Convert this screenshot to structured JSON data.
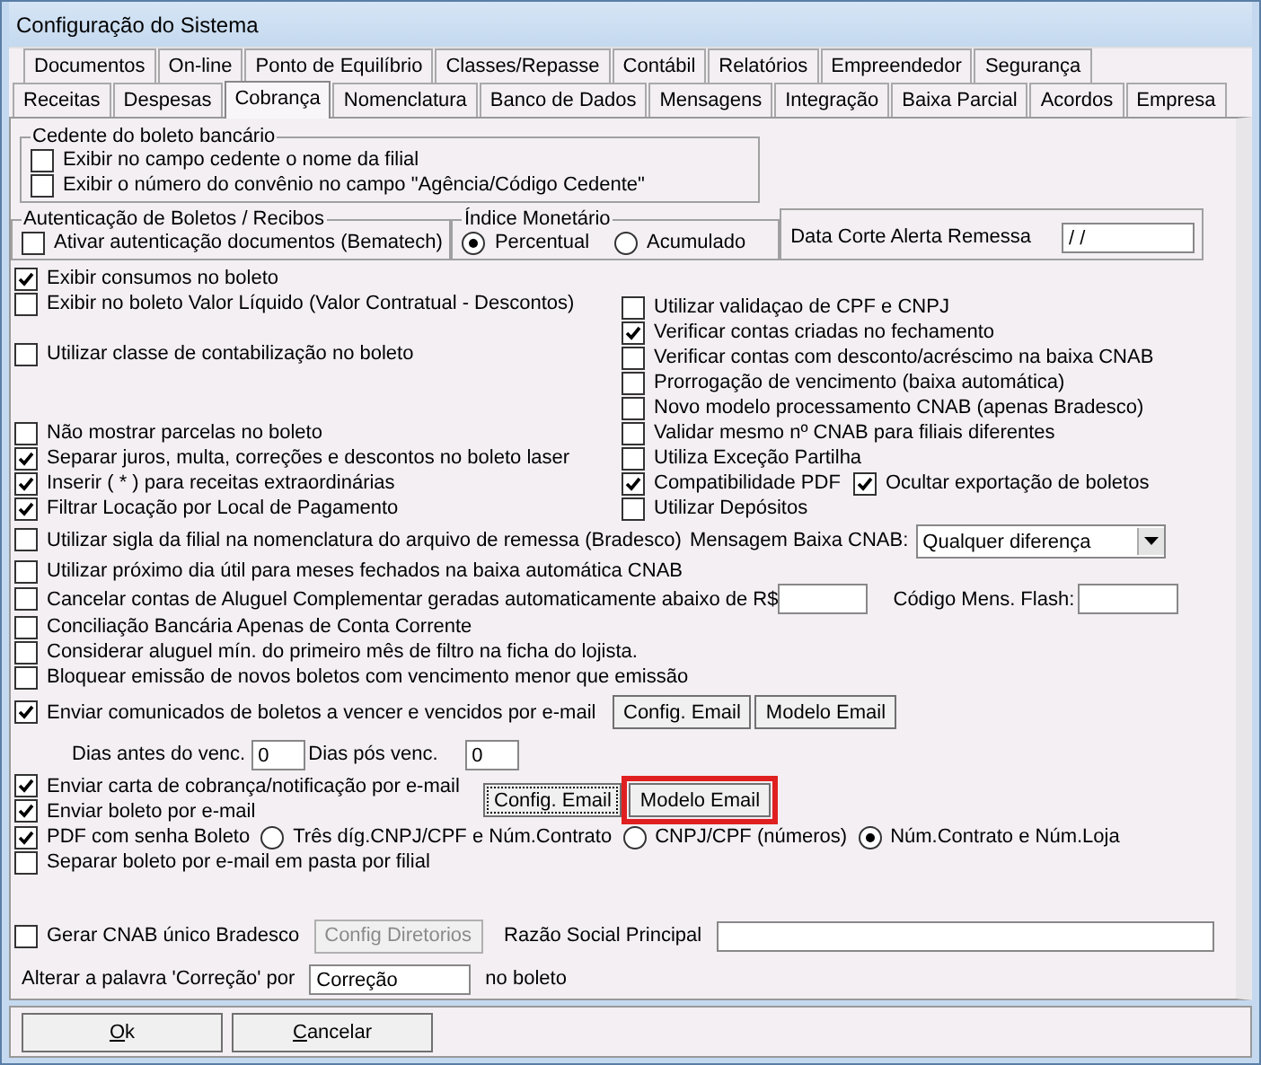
{
  "window": {
    "title": "Configuração do Sistema"
  },
  "tabs_row_1": [
    {
      "label": "Documentos",
      "selected": false
    },
    {
      "label": "On-line",
      "selected": false
    },
    {
      "label": "Ponto de Equilíbrio",
      "selected": false
    },
    {
      "label": "Classes/Repasse",
      "selected": false
    },
    {
      "label": "Contábil",
      "selected": false
    },
    {
      "label": "Relatórios",
      "selected": false
    },
    {
      "label": "Empreendedor",
      "selected": false
    },
    {
      "label": "Segurança",
      "selected": false
    }
  ],
  "tabs_row_2": [
    {
      "label": "Receitas",
      "selected": false
    },
    {
      "label": "Despesas",
      "selected": false
    },
    {
      "label": "Cobrança",
      "selected": true
    },
    {
      "label": "Nomenclatura",
      "selected": false
    },
    {
      "label": "Banco de Dados",
      "selected": false
    },
    {
      "label": "Mensagens",
      "selected": false
    },
    {
      "label": "Integração",
      "selected": false
    },
    {
      "label": "Baixa Parcial",
      "selected": false
    },
    {
      "label": "Acordos",
      "selected": false
    },
    {
      "label": "Empresa",
      "selected": false
    }
  ],
  "cedente_group": {
    "title": "Cedente do boleto bancário",
    "options": [
      {
        "label": "Exibir no campo cedente o nome da filial",
        "checked": false
      },
      {
        "label": "Exibir o número do convênio no campo \"Agência/Código Cedente\"",
        "checked": false
      }
    ]
  },
  "autenticacao_group": {
    "title": "Autenticação de Boletos / Recibos",
    "option": {
      "label": "Ativar autenticação documentos (Bematech)",
      "checked": false
    }
  },
  "indice_group": {
    "title": "Índice Monetário",
    "options": [
      {
        "label": "Percentual",
        "selected": true
      },
      {
        "label": "Acumulado",
        "selected": false
      }
    ]
  },
  "data_corte": {
    "label": "Data Corte Alerta Remessa",
    "value": "/ /"
  },
  "left_blocks": [
    {
      "options": [
        {
          "label": "Exibir consumos no boleto",
          "checked": true
        },
        {
          "label": "Exibir no boleto Valor Líquido (Valor Contratual - Descontos)",
          "checked": false
        }
      ]
    },
    {
      "options": [
        {
          "label": "Utilizar classe de contabilização no boleto",
          "checked": false
        }
      ]
    },
    {
      "options": [
        {
          "label": "Não mostrar parcelas no boleto",
          "checked": false
        },
        {
          "label": "Separar juros, multa, correções e descontos no boleto laser",
          "checked": true
        },
        {
          "label": "Inserir ( * ) para receitas extraordinárias",
          "checked": true
        },
        {
          "label": "Filtrar Locação por Local de Pagamento",
          "checked": true
        }
      ]
    }
  ],
  "right_options": [
    {
      "label": "Utilizar validaçao de CPF e CNPJ",
      "checked": false
    },
    {
      "label": "Verificar contas criadas no fechamento",
      "checked": true
    },
    {
      "label": "Verificar contas com desconto/acréscimo na baixa CNAB",
      "checked": false
    },
    {
      "label": "Prorrogação de vencimento (baixa automática)",
      "checked": false
    },
    {
      "label": "Novo modelo processamento CNAB (apenas Bradesco)",
      "checked": false
    },
    {
      "label": "Validar mesmo nº CNAB para filiais diferentes",
      "checked": false
    },
    {
      "label": "Utiliza Exceção Partilha",
      "checked": false
    },
    {
      "label": "Compatibilidade PDF",
      "checked": true,
      "side": {
        "label": "Ocultar exportação de boletos",
        "checked": true
      }
    },
    {
      "label": "Utilizar Depósitos",
      "checked": false
    }
  ],
  "sigla": {
    "label": "Utilizar sigla da filial na nomenclatura do arquivo de remessa (Bradesco)",
    "checked": false
  },
  "mensagem_baixa": {
    "label": "Mensagem Baixa CNAB:",
    "value": "Qualquer diferença"
  },
  "proximo_dia": {
    "label": "Utilizar próximo dia útil para meses fechados na baixa automática CNAB",
    "checked": false
  },
  "cancelar_contas": {
    "label": "Cancelar contas de Aluguel Complementar geradas automaticamente abaixo de R$",
    "checked": false
  },
  "codigo_flash": {
    "label": "Código Mens. Flash:"
  },
  "simple_options": [
    {
      "label": "Conciliação Bancária Apenas de Conta Corrente",
      "checked": false
    },
    {
      "label": "Considerar aluguel mín. do primeiro mês de filtro na ficha do lojista.",
      "checked": false
    },
    {
      "label": "Bloquear emissão de novos boletos com vencimento menor que emissão",
      "checked": false
    }
  ],
  "comunicados": {
    "label": "Enviar comunicados de boletos a vencer e vencidos por e-mail",
    "checked": true,
    "buttons": [
      "Config. Email",
      "Modelo Email"
    ]
  },
  "dias": {
    "antes_label": "Dias antes do venc.",
    "antes_value": "0",
    "pos_label": "Dias pós venc.",
    "pos_value": "0"
  },
  "email_options": [
    {
      "label": "Enviar carta de cobrança/notificação por e-mail",
      "checked": true
    },
    {
      "label": "Enviar boleto por e-mail",
      "checked": true
    }
  ],
  "email_buttons": [
    {
      "label": "Config. Email",
      "focused": true,
      "highlighted": false
    },
    {
      "label": "Modelo Email",
      "focused": false,
      "highlighted": true
    }
  ],
  "pdf_senha": {
    "label": "PDF com senha Boleto",
    "checked": true,
    "choices": [
      {
        "label": "Três díg.CNPJ/CPF e Núm.Contrato",
        "selected": false
      },
      {
        "label": "CNPJ/CPF (números)",
        "selected": false
      },
      {
        "label": "Núm.Contrato e Núm.Loja",
        "selected": true
      }
    ]
  },
  "separar_boleto": {
    "label": "Separar boleto por e-mail em pasta por filial",
    "checked": false
  },
  "cnab": {
    "label": "Gerar CNAB único Bradesco",
    "checked": false,
    "button": {
      "label": "Config Diretorios",
      "disabled": true
    },
    "razao_label": "Razão Social Principal"
  },
  "correcao": {
    "label": "Alterar a palavra 'Correção' por",
    "value": "Correção",
    "suffix": "no boleto"
  },
  "buttons": [
    {
      "label": "Ok",
      "underline_first": true
    },
    {
      "label": "Cancelar",
      "underline_first": true
    }
  ]
}
